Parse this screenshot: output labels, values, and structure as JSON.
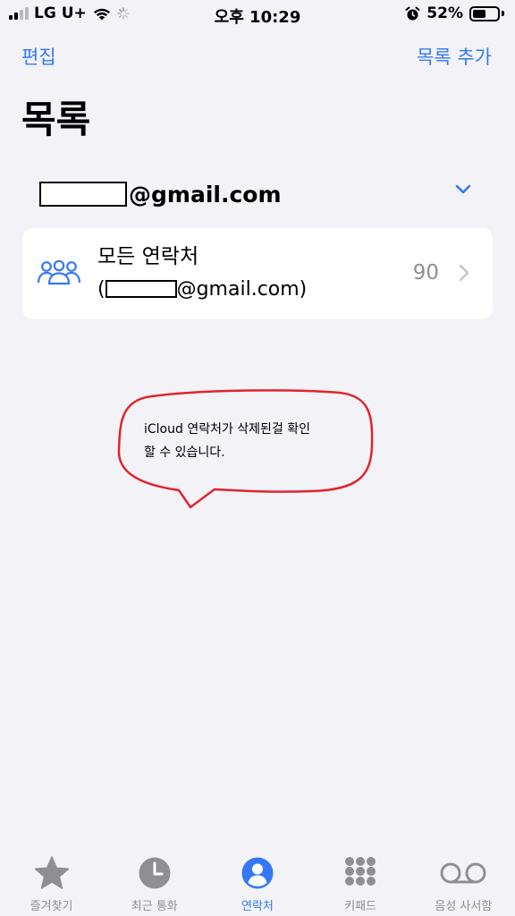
{
  "status_bar": {
    "carrier": "LG U+",
    "time": "오후 10:29",
    "battery": "52%",
    "battery_level": 0.52
  },
  "nav": {
    "edit_label": "편집",
    "add_list_label": "목록 추가"
  },
  "page_title": "목록",
  "account": {
    "email_suffix": "@gmail.com"
  },
  "list_card": {
    "title": "모든 연락처",
    "subtitle_open": "(",
    "subtitle_suffix": "@gmail.com)",
    "count": "90"
  },
  "annotation": {
    "line1": "iCloud 연락처가 삭제된걸 확인",
    "line2": "할 수 있습니다."
  },
  "tab_bar": {
    "tabs": [
      {
        "label": "즐겨찾기",
        "icon": "star-icon"
      },
      {
        "label": "최근 통화",
        "icon": "clock-icon"
      },
      {
        "label": "연락처",
        "icon": "contact-icon"
      },
      {
        "label": "키패드",
        "icon": "keypad-icon"
      },
      {
        "label": "음성 사서함",
        "icon": "voicemail-icon"
      }
    ],
    "active_index": 2
  },
  "colors": {
    "accent": "#3478f6",
    "background": "#f2f2f7",
    "annotation": "#e0242e",
    "inactive": "#8e8e93"
  }
}
